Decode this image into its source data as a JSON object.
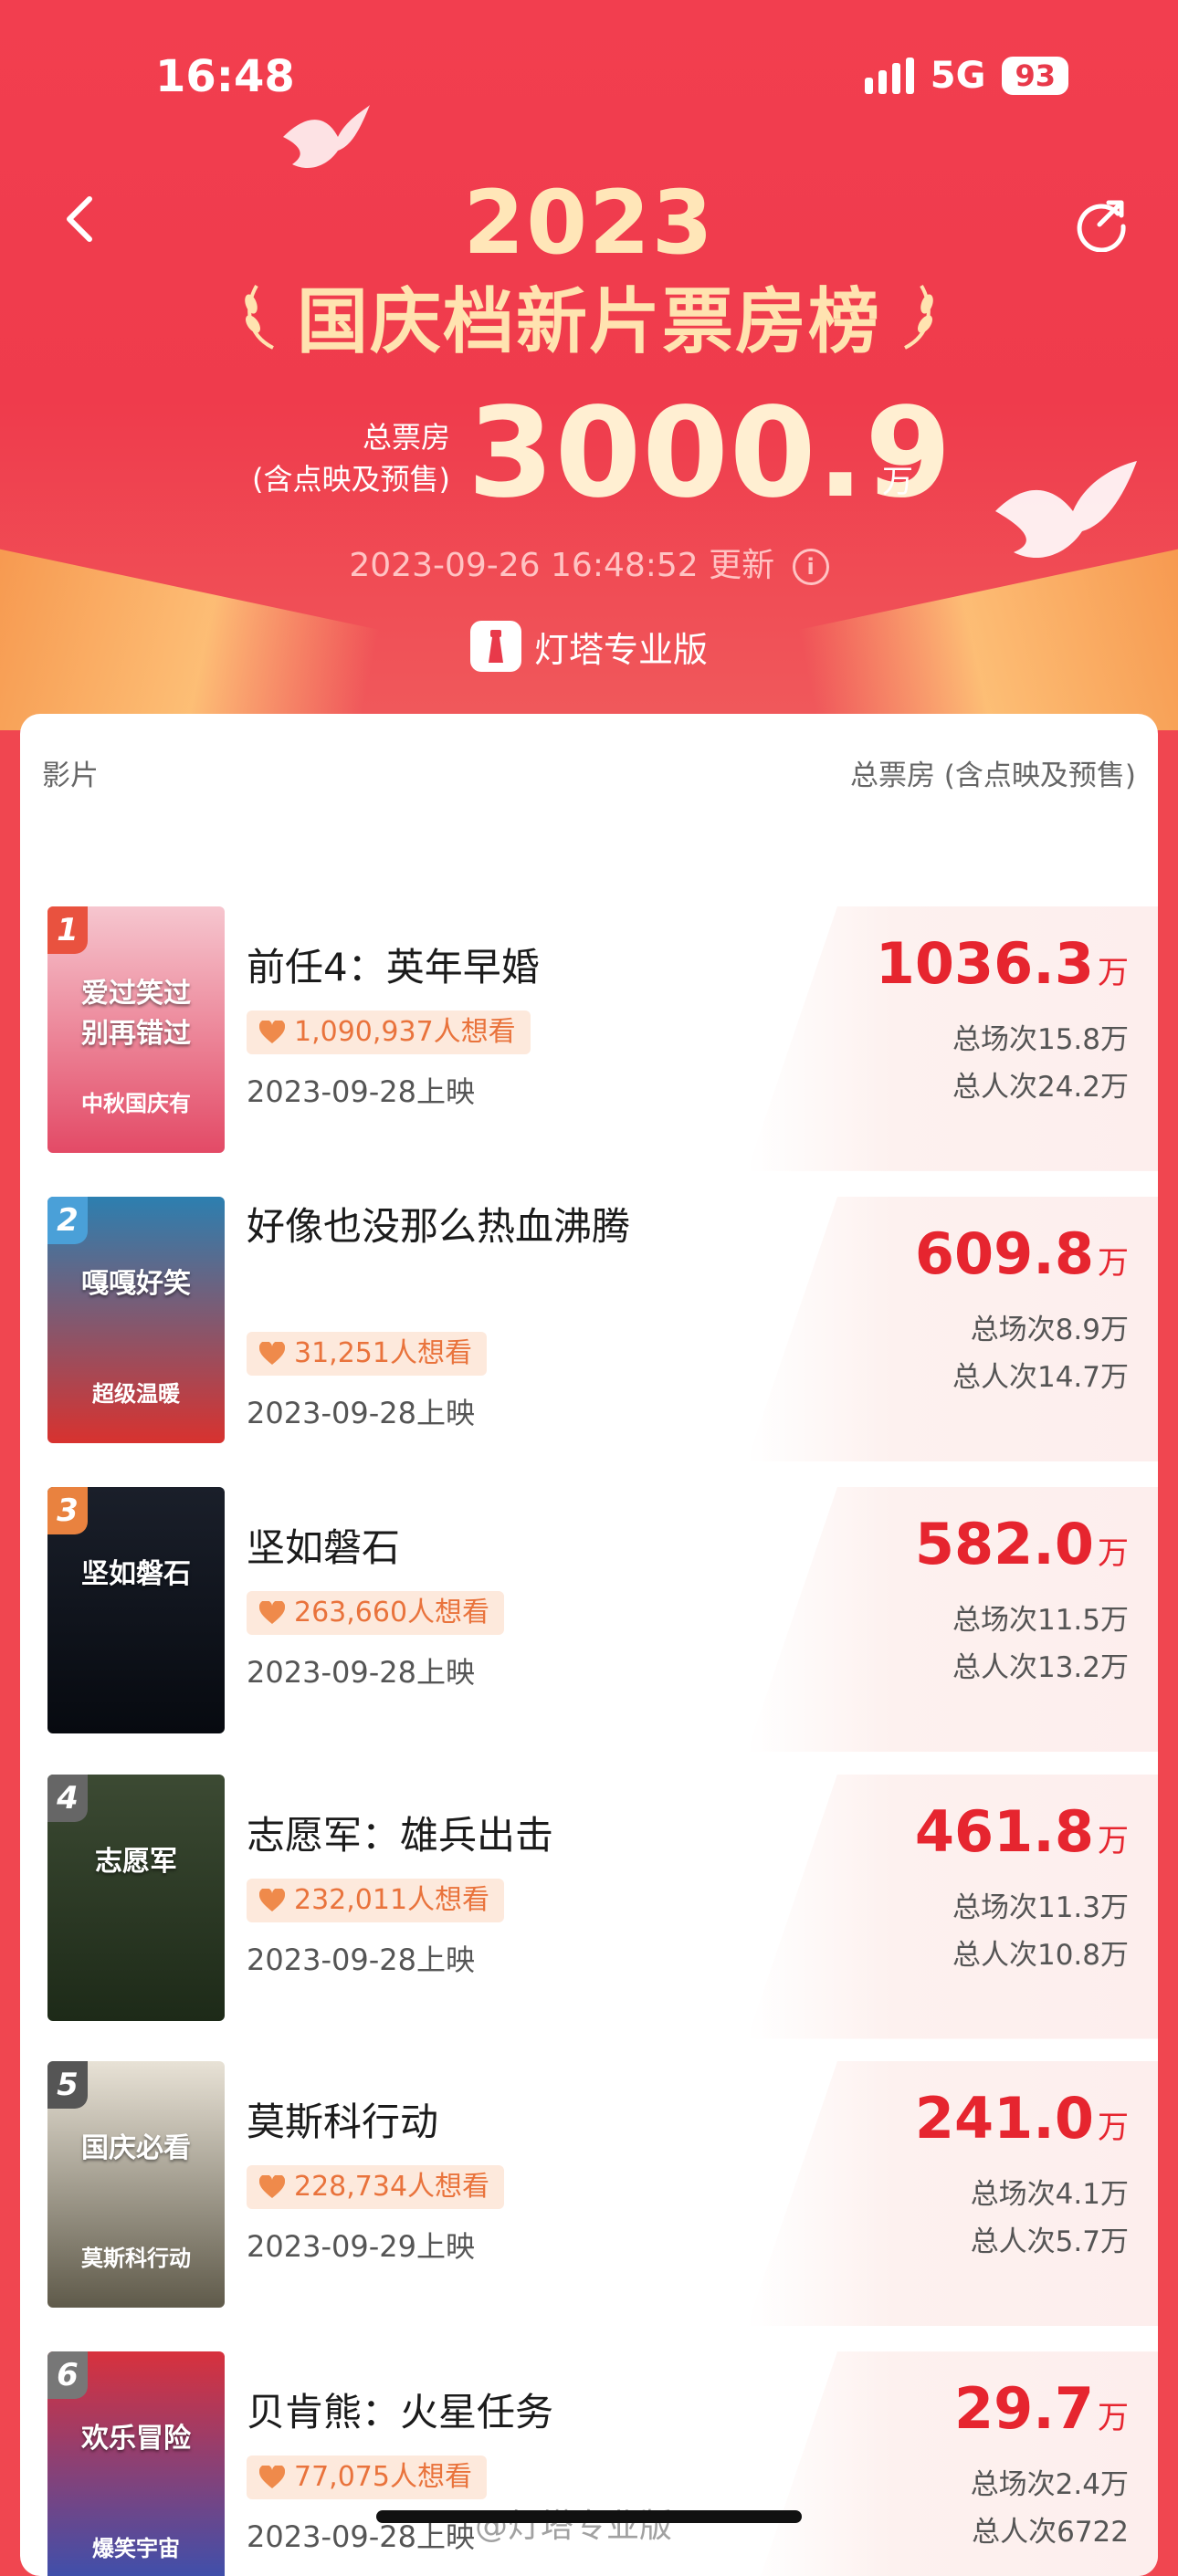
{
  "status": {
    "time": "16:48",
    "network": "5G",
    "battery": "93"
  },
  "header": {
    "year": "2023",
    "title": "国庆档新片票房榜",
    "total_label_line1": "总票房",
    "total_label_line2": "(含点映及预售)",
    "total_value": "3000.9",
    "total_unit": "万",
    "updated_time": "2023-09-26 16:48:52",
    "updated_suffix": "更新",
    "brand": "灯塔专业版"
  },
  "table": {
    "left_header": "影片",
    "right_header": "总票房 (含点映及预售)",
    "movies": [
      {
        "rank": "1",
        "title": "前任4：英年早婚",
        "want": "1,090,937人想看",
        "release": "2023-09-28上映",
        "gross": "1036.3",
        "unit": "万",
        "shows": "总场次15.8万",
        "admissions": "总人次24.2万",
        "poster_text": "爱过笑过\n别再错过",
        "poster_sub": "中秋国庆有"
      },
      {
        "rank": "2",
        "title": "好像也没那么热血沸腾",
        "want": "31,251人想看",
        "release": "2023-09-28上映",
        "gross": "609.8",
        "unit": "万",
        "shows": "总场次8.9万",
        "admissions": "总人次14.7万",
        "poster_text": "嘎嘎好笑",
        "poster_sub": "超级温暖"
      },
      {
        "rank": "3",
        "title": "坚如磐石",
        "want": "263,660人想看",
        "release": "2023-09-28上映",
        "gross": "582.0",
        "unit": "万",
        "shows": "总场次11.5万",
        "admissions": "总人次13.2万",
        "poster_text": "坚如磐石",
        "poster_sub": ""
      },
      {
        "rank": "4",
        "title": "志愿军：雄兵出击",
        "want": "232,011人想看",
        "release": "2023-09-28上映",
        "gross": "461.8",
        "unit": "万",
        "shows": "总场次11.3万",
        "admissions": "总人次10.8万",
        "poster_text": "志愿军",
        "poster_sub": ""
      },
      {
        "rank": "5",
        "title": "莫斯科行动",
        "want": "228,734人想看",
        "release": "2023-09-29上映",
        "gross": "241.0",
        "unit": "万",
        "shows": "总场次4.1万",
        "admissions": "总人次5.7万",
        "poster_text": "国庆必看",
        "poster_sub": "莫斯科行动"
      },
      {
        "rank": "6",
        "title": "贝肯熊：火星任务",
        "want": "77,075人想看",
        "release": "2023-09-28上映",
        "gross": "29.7",
        "unit": "万",
        "shows": "总场次2.4万",
        "admissions": "总人次6722",
        "poster_text": "欢乐冒险",
        "poster_sub": "爆笑宇宙"
      }
    ]
  },
  "footer": {
    "watermark": "@灯塔专业版"
  },
  "colors": {
    "accent": "#e6252f",
    "hero": "#ef3b4c",
    "gold": "#ffe3b0"
  }
}
